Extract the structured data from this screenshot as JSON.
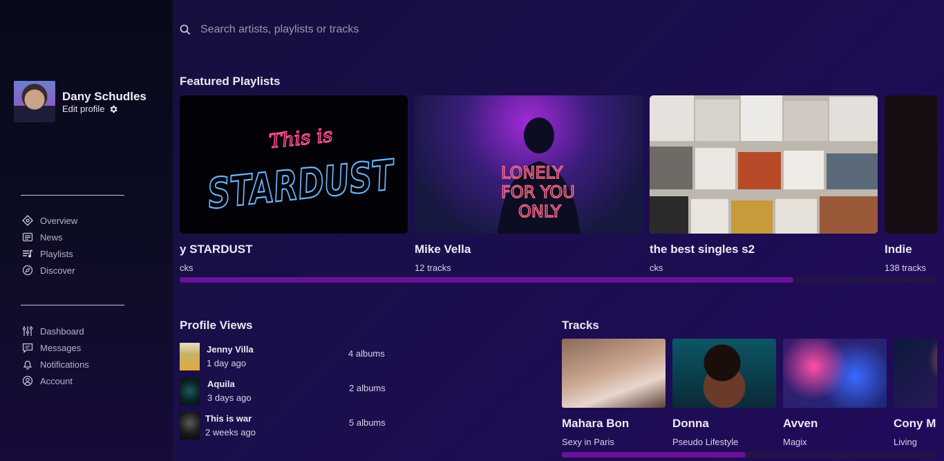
{
  "user": {
    "name": "Dany Schudles",
    "edit_label": "Edit profile"
  },
  "nav_primary": [
    {
      "label": "Overview",
      "icon": "compass-diamond-icon"
    },
    {
      "label": "News",
      "icon": "newspaper-icon"
    },
    {
      "label": "Playlists",
      "icon": "playlist-icon"
    },
    {
      "label": "Discover",
      "icon": "discover-compass-icon"
    }
  ],
  "nav_secondary": [
    {
      "label": "Dashboard",
      "icon": "sliders-icon"
    },
    {
      "label": "Messages",
      "icon": "chat-icon"
    },
    {
      "label": "Notifications",
      "icon": "bell-icon"
    },
    {
      "label": "Account",
      "icon": "user-circle-icon"
    }
  ],
  "search": {
    "placeholder": "Search artists, playlists or tracks"
  },
  "featured": {
    "title": "Featured Playlists",
    "items": [
      {
        "title": "y STARDUST",
        "subtitle": "cks",
        "cover_text_1": "This is",
        "cover_text_2": "STARDUST"
      },
      {
        "title": "Mike Vella",
        "subtitle": "12 tracks",
        "cover_text_1": "LONELY",
        "cover_text_2": "FOR YOU",
        "cover_text_3": "ONLY"
      },
      {
        "title": "the best singles s2",
        "subtitle": "cks"
      },
      {
        "title": "Indie",
        "subtitle": "138 tracks"
      }
    ],
    "scroll_fraction": 0.81
  },
  "profile_views": {
    "title": "Profile Views",
    "items": [
      {
        "name": "Jenny Villa",
        "time": "1 day ago",
        "albums": "4 albums"
      },
      {
        "name": "Aquila",
        "time": "3 days ago",
        "albums": "2 albums"
      },
      {
        "name": "This is war",
        "time": "2 weeks ago",
        "albums": "5 albums"
      }
    ]
  },
  "tracks": {
    "title": "Tracks",
    "items": [
      {
        "name": "Mahara Bon",
        "album": "Sexy in Paris"
      },
      {
        "name": "Donna",
        "album": "Pseudo Lifestyle"
      },
      {
        "name": "Avven",
        "album": "Magix"
      },
      {
        "name": "Cony M",
        "album": "Living"
      }
    ],
    "scroll_fraction": 0.49
  },
  "colors": {
    "accent": "#6a1199",
    "track": "#231446",
    "sidebar": "#0a0a1e"
  }
}
